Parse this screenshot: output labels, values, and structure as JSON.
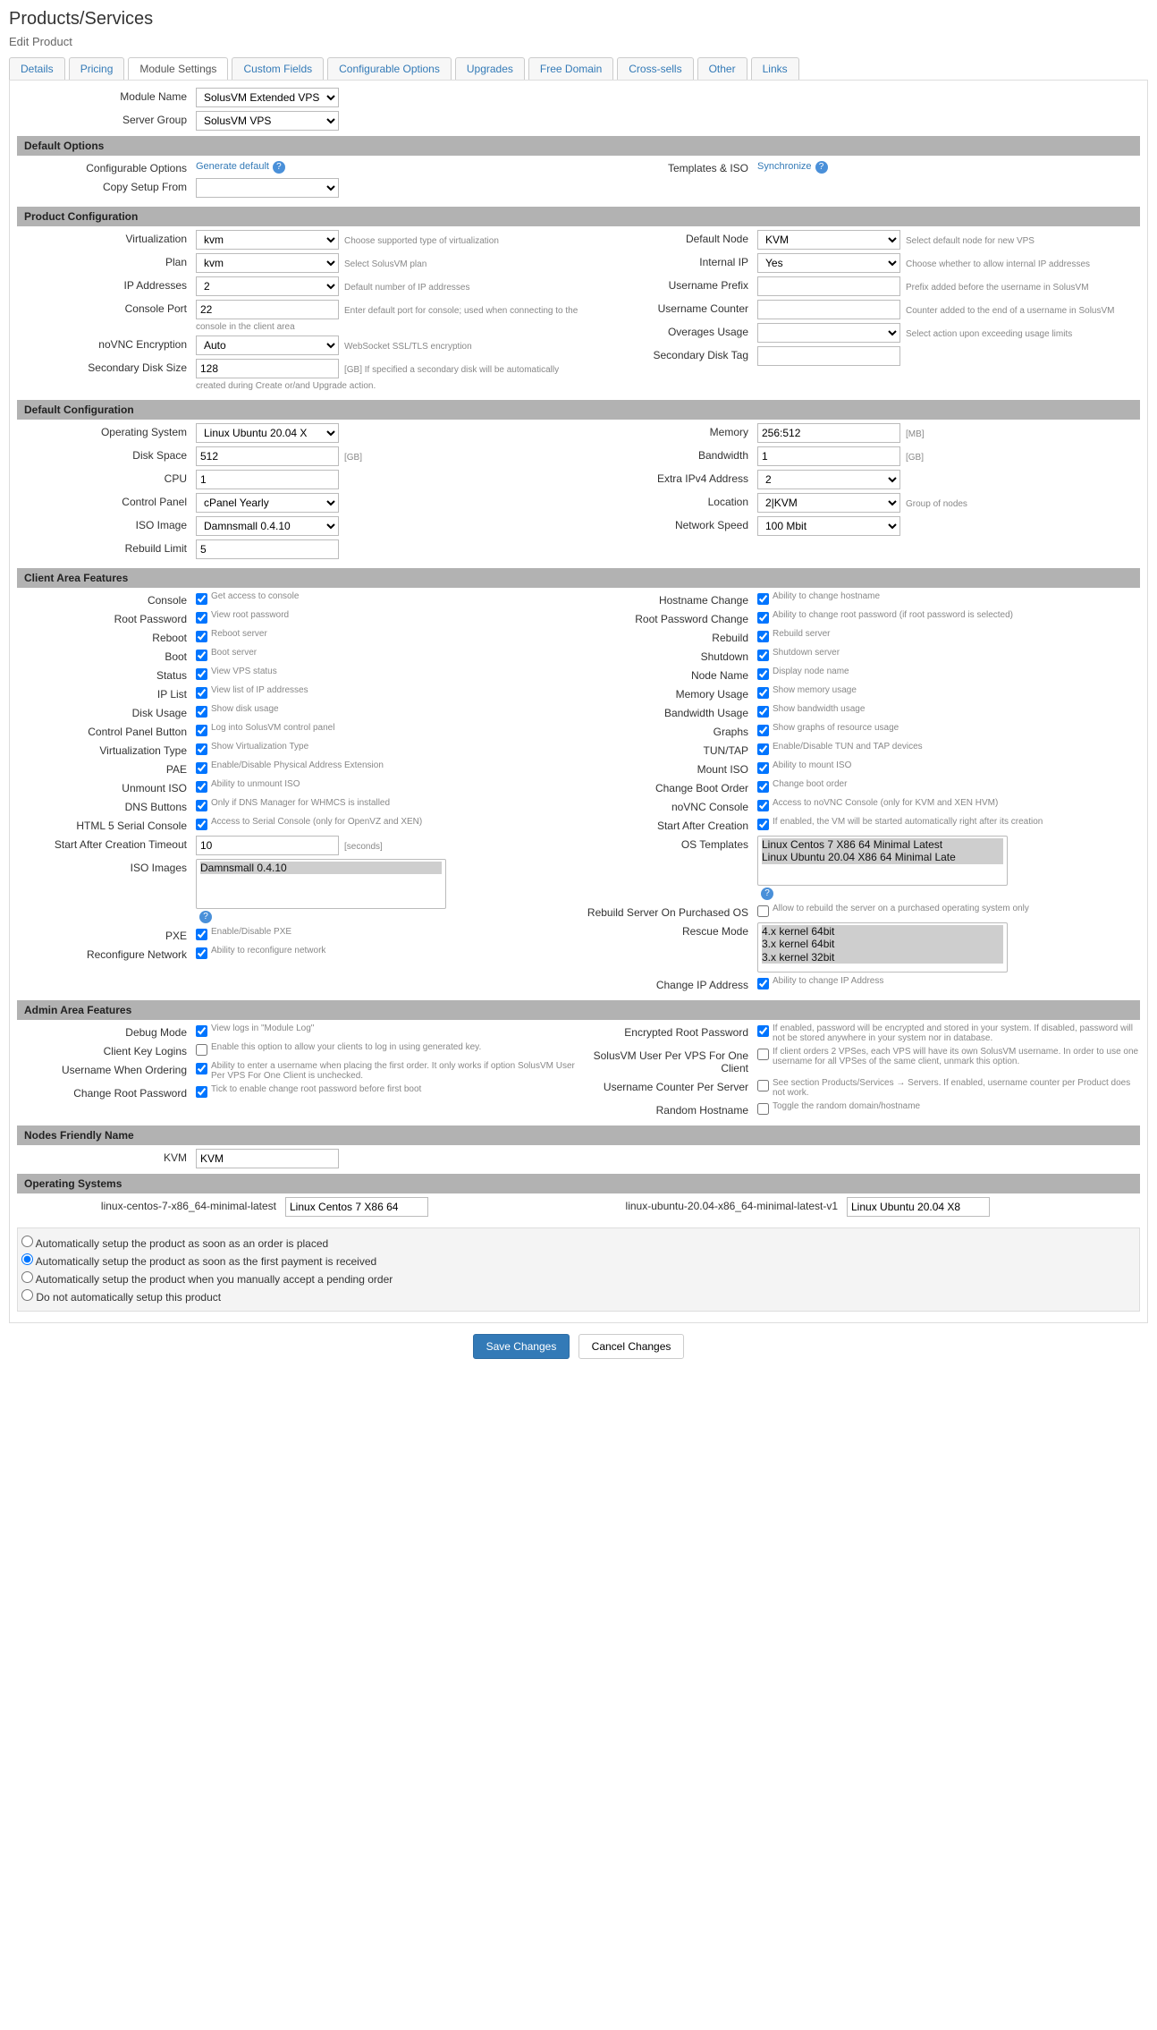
{
  "page": {
    "title": "Products/Services",
    "subtitle": "Edit Product"
  },
  "tabs": [
    "Details",
    "Pricing",
    "Module Settings",
    "Custom Fields",
    "Configurable Options",
    "Upgrades",
    "Free Domain",
    "Cross-sells",
    "Other",
    "Links"
  ],
  "activeTab": 2,
  "top": {
    "moduleName": {
      "label": "Module Name",
      "value": "SolusVM Extended VPS"
    },
    "serverGroup": {
      "label": "Server Group",
      "value": "SolusVM VPS"
    }
  },
  "sections": {
    "defaultOptions": {
      "title": "Default Options",
      "left": [
        {
          "label": "Configurable Options",
          "link": "Generate default",
          "help": true
        },
        {
          "label": "Copy Setup From",
          "select": ""
        }
      ],
      "right": [
        {
          "label": "Templates & ISO",
          "link": "Synchronize",
          "help": true
        }
      ]
    },
    "productConfig": {
      "title": "Product Configuration",
      "left": [
        {
          "label": "Virtualization",
          "select": "kvm",
          "hint": "Choose supported type of virtualization"
        },
        {
          "label": "Plan",
          "select": "kvm",
          "hint": "Select SolusVM plan"
        },
        {
          "label": "IP Addresses",
          "select": "2",
          "hint": "Default number of IP addresses"
        },
        {
          "label": "Console Port",
          "text": "22",
          "hint": "Enter default port for console; used when connecting to the console in the client area"
        },
        {
          "label": "noVNC Encryption",
          "select": "Auto",
          "hint": "WebSocket SSL/TLS encryption"
        },
        {
          "label": "Secondary Disk Size",
          "text": "128",
          "hint": "[GB] If specified a secondary disk will be automatically created during Create or/and Upgrade action."
        }
      ],
      "right": [
        {
          "label": "Default Node",
          "select": "KVM",
          "hint": "Select default node for new VPS"
        },
        {
          "label": "Internal IP",
          "select": "Yes",
          "hint": "Choose whether to allow internal IP addresses"
        },
        {
          "label": "Username Prefix",
          "text": "",
          "hint": "Prefix added before the username in SolusVM"
        },
        {
          "label": "Username Counter",
          "text": "",
          "hint": "Counter added to the end of a username in SolusVM"
        },
        {
          "label": "Overages Usage",
          "select": "",
          "hint": "Select action upon exceeding usage limits"
        },
        {
          "label": "Secondary Disk Tag",
          "text": ""
        }
      ]
    },
    "defaultConfig": {
      "title": "Default Configuration",
      "left": [
        {
          "label": "Operating System",
          "select": "Linux Ubuntu 20.04 X"
        },
        {
          "label": "Disk Space",
          "text": "512",
          "hint": "[GB]"
        },
        {
          "label": "CPU",
          "text": "1"
        },
        {
          "label": "Control Panel",
          "select": "cPanel Yearly"
        },
        {
          "label": "ISO Image",
          "select": "Damnsmall 0.4.10"
        },
        {
          "label": "Rebuild Limit",
          "text": "5"
        }
      ],
      "right": [
        {
          "label": "Memory",
          "text": "256:512",
          "hint": "[MB]"
        },
        {
          "label": "Bandwidth",
          "text": "1",
          "hint": "[GB]"
        },
        {
          "label": "Extra IPv4 Address",
          "select": "2"
        },
        {
          "label": "Location",
          "select": "2|KVM",
          "hint": "Group of nodes"
        },
        {
          "label": "Network Speed",
          "select": "100 Mbit"
        }
      ]
    },
    "clientArea": {
      "title": "Client Area Features",
      "left": [
        {
          "label": "Console",
          "chk": true,
          "txt": "Get access to console"
        },
        {
          "label": "Root Password",
          "chk": true,
          "txt": "View root password"
        },
        {
          "label": "Reboot",
          "chk": true,
          "txt": "Reboot server"
        },
        {
          "label": "Boot",
          "chk": true,
          "txt": "Boot server"
        },
        {
          "label": "Status",
          "chk": true,
          "txt": "View VPS status"
        },
        {
          "label": "IP List",
          "chk": true,
          "txt": "View list of IP addresses"
        },
        {
          "label": "Disk Usage",
          "chk": true,
          "txt": "Show disk usage"
        },
        {
          "label": "Control Panel Button",
          "chk": true,
          "txt": "Log into SolusVM control panel"
        },
        {
          "label": "Virtualization Type",
          "chk": true,
          "txt": "Show Virtualization Type"
        },
        {
          "label": "PAE",
          "chk": true,
          "txt": "Enable/Disable Physical Address Extension"
        },
        {
          "label": "Unmount ISO",
          "chk": true,
          "txt": "Ability to unmount ISO"
        },
        {
          "label": "DNS Buttons",
          "chk": true,
          "txt": "Only if DNS Manager for WHMCS is installed"
        },
        {
          "label": "HTML 5 Serial Console",
          "chk": true,
          "txt": "Access to Serial Console (only for OpenVZ and XEN)"
        },
        {
          "label": "Start After Creation Timeout",
          "text": "10",
          "hint": "[seconds]"
        },
        {
          "label": "ISO Images",
          "multi": [
            "Damnsmall 0.4.10"
          ],
          "help": true
        },
        {
          "label": "PXE",
          "chk": true,
          "txt": "Enable/Disable PXE"
        },
        {
          "label": "Reconfigure Network",
          "chk": true,
          "txt": "Ability to reconfigure network"
        }
      ],
      "right": [
        {
          "label": "Hostname Change",
          "chk": true,
          "txt": "Ability to change hostname"
        },
        {
          "label": "Root Password Change",
          "chk": true,
          "txt": "Ability to change root password (if root password is selected)"
        },
        {
          "label": "Rebuild",
          "chk": true,
          "txt": "Rebuild server"
        },
        {
          "label": "Shutdown",
          "chk": true,
          "txt": "Shutdown server"
        },
        {
          "label": "Node Name",
          "chk": true,
          "txt": "Display node name"
        },
        {
          "label": "Memory Usage",
          "chk": true,
          "txt": "Show memory usage"
        },
        {
          "label": "Bandwidth Usage",
          "chk": true,
          "txt": "Show bandwidth usage"
        },
        {
          "label": "Graphs",
          "chk": true,
          "txt": "Show graphs of resource usage"
        },
        {
          "label": "TUN/TAP",
          "chk": true,
          "txt": "Enable/Disable TUN and TAP devices"
        },
        {
          "label": "Mount ISO",
          "chk": true,
          "txt": "Ability to mount ISO"
        },
        {
          "label": "Change Boot Order",
          "chk": true,
          "txt": "Change boot order"
        },
        {
          "label": "noVNC Console",
          "chk": true,
          "txt": "Access to noVNC Console (only for KVM and XEN HVM)"
        },
        {
          "label": "Start After Creation",
          "chk": true,
          "txt": "If enabled, the VM will be started automatically right after its creation"
        },
        {
          "label": "OS Templates",
          "multi": [
            "Linux Centos 7 X86 64 Minimal Latest",
            "Linux Ubuntu 20.04 X86 64 Minimal Late"
          ],
          "help": true
        },
        {
          "label": "Rebuild Server On Purchased OS",
          "chk": false,
          "txt": "Allow to rebuild the server on a purchased operating system only"
        },
        {
          "label": "Rescue Mode",
          "multi": [
            "4.x kernel 64bit",
            "3.x kernel 64bit",
            "3.x kernel 32bit"
          ]
        },
        {
          "label": "Change IP Address",
          "chk": true,
          "txt": "Ability to change IP Address"
        }
      ]
    },
    "adminArea": {
      "title": "Admin Area Features",
      "left": [
        {
          "label": "Debug Mode",
          "chk": true,
          "txt": "View logs in \"Module Log\""
        },
        {
          "label": "Client Key Logins",
          "chk": false,
          "txt": "Enable this option to allow your clients to log in using generated key."
        },
        {
          "label": "Username When Ordering",
          "chk": true,
          "txt": "Ability to enter a username when placing the first order. It only works if option SolusVM User Per VPS For One Client is unchecked."
        },
        {
          "label": "Change Root Password",
          "chk": true,
          "txt": "Tick to enable change root password before first boot"
        }
      ],
      "right": [
        {
          "label": "Encrypted Root Password",
          "chk": true,
          "txt": "If enabled, password will be encrypted and stored in your system. If disabled, password will not be stored anywhere in your system nor in database."
        },
        {
          "label": "SolusVM User Per VPS For One Client",
          "chk": false,
          "txt": "If client orders 2 VPSes, each VPS will have its own SolusVM username. In order to use one username for all VPSes of the same client, unmark this option."
        },
        {
          "label": "Username Counter Per Server",
          "chk": false,
          "txt": "See section Products/Services → Servers. If enabled, username counter per Product does not work."
        },
        {
          "label": "Random Hostname",
          "chk": false,
          "txt": "Toggle the random domain/hostname"
        }
      ]
    },
    "nodesFriendly": {
      "title": "Nodes Friendly Name",
      "items": [
        {
          "label": "KVM",
          "text": "KVM"
        }
      ]
    },
    "operatingSystems": {
      "title": "Operating Systems",
      "items": [
        {
          "label": "linux-centos-7-x86_64-minimal-latest",
          "text": "Linux Centos 7 X86 64"
        },
        {
          "label": "linux-ubuntu-20.04-x86_64-minimal-latest-v1",
          "text": "Linux Ubuntu 20.04 X8"
        }
      ]
    }
  },
  "radios": {
    "options": [
      "Automatically setup the product as soon as an order is placed",
      "Automatically setup the product as soon as the first payment is received",
      "Automatically setup the product when you manually accept a pending order",
      "Do not automatically setup this product"
    ],
    "selected": 1
  },
  "buttons": {
    "save": "Save Changes",
    "cancel": "Cancel Changes"
  }
}
